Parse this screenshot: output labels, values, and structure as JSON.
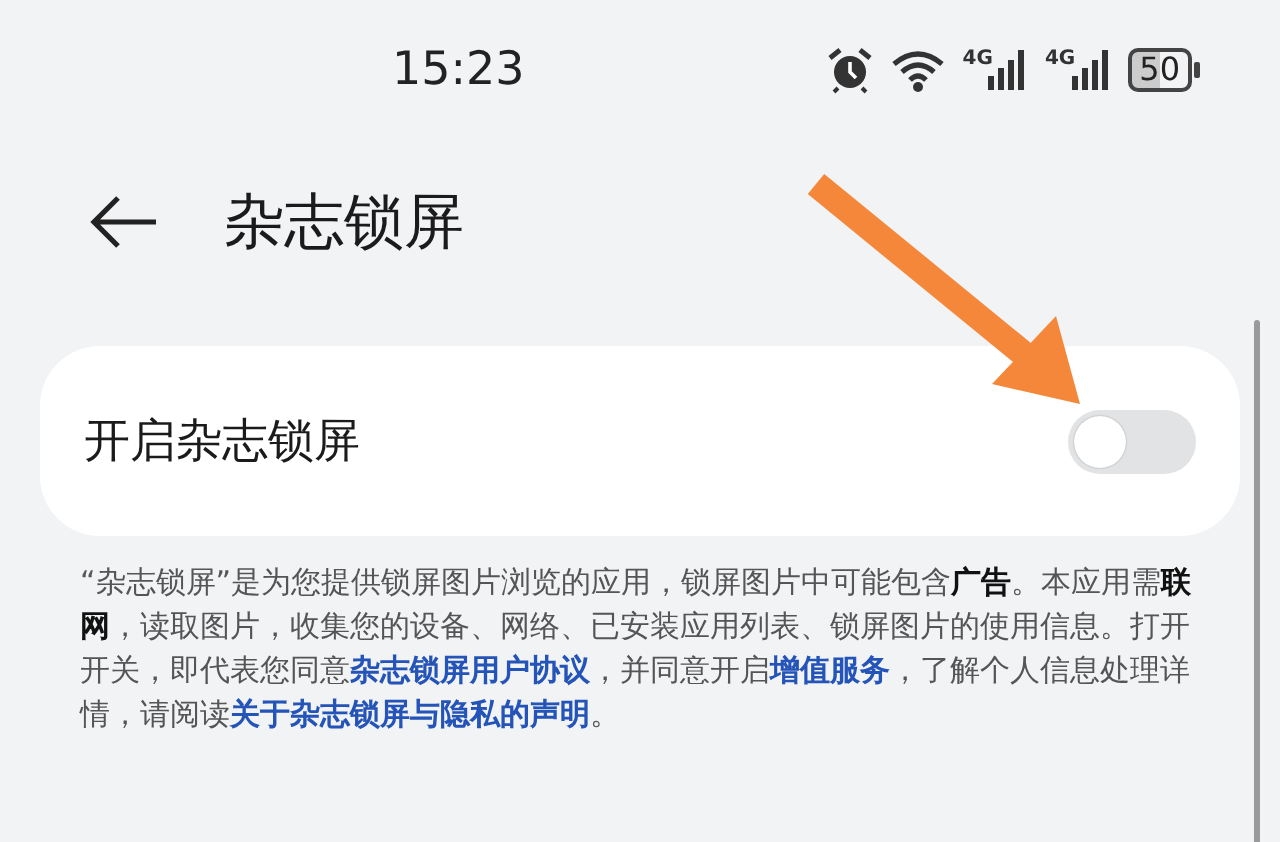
{
  "status_bar": {
    "time": "15:23",
    "networks": [
      "4G",
      "4G"
    ],
    "battery": "50"
  },
  "header": {
    "title": "杂志锁屏"
  },
  "settings": [
    {
      "kind": "switch",
      "label": "开启杂志锁屏",
      "on": false
    }
  ],
  "notice": [
    {
      "kind": "text",
      "text": "“杂志锁屏”是为您提供锁屏图片浏览的应用，锁屏图片中可能包含**广告**。本应用需**联网**，读取图片，收集您的设备、网络、已安装应用列表、锁屏图片的使用信息。打开开关，即代表您同意"
    },
    {
      "kind": "link",
      "text": "杂志锁屏用户协议"
    },
    {
      "kind": "text",
      "text": "，并同意开启"
    },
    {
      "kind": "link",
      "text": "增值服务"
    },
    {
      "kind": "text",
      "text": "，了解个人信息处理详情，请阅读"
    },
    {
      "kind": "link",
      "text": "关于杂志锁屏与隐私的声明"
    },
    {
      "kind": "text",
      "text": "。"
    }
  ]
}
